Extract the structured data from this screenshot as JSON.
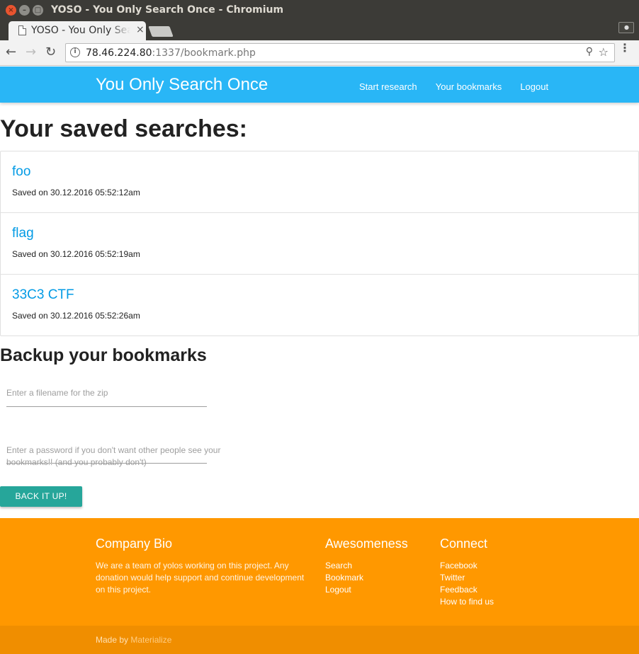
{
  "window": {
    "title": "YOSO - You Only Search Once - Chromium",
    "close_glyph": "×",
    "min_glyph": "–",
    "max_glyph": "□"
  },
  "tab": {
    "title": "YOSO - You Only Search Once",
    "close_glyph": "×"
  },
  "toolbar": {
    "url_host": "78.46.224.80",
    "url_rest": ":1337/bookmark.php",
    "back_glyph": "←",
    "forward_glyph": "→",
    "reload_glyph": "↻",
    "info_glyph": "i",
    "zoom_glyph": "⚲",
    "star_glyph": "☆",
    "menu_glyph": "⋮"
  },
  "navbar": {
    "brand": "You Only Search Once",
    "links": [
      "Start research",
      "Your bookmarks",
      "Logout"
    ],
    "color": "#29b6f6"
  },
  "main": {
    "title": "Your saved searches:",
    "searches": [
      {
        "title": "foo",
        "saved": "Saved on 30.12.2016 05:52:12am"
      },
      {
        "title": "flag",
        "saved": "Saved on 30.12.2016 05:52:19am"
      },
      {
        "title": "33C3 CTF",
        "saved": "Saved on 30.12.2016 05:52:26am"
      }
    ],
    "backup": {
      "title": "Backup your bookmarks",
      "filename_placeholder": "Enter a filename for the zip",
      "password_placeholder": "Enter a password if you don't want other people see your bookmarks!! (and you probably don't)",
      "button_label": "BACK IT UP!",
      "button_color": "#26a69a"
    }
  },
  "footer": {
    "color": "#ff9800",
    "bio": {
      "title": "Company Bio",
      "text": "We are a team of yolos working on this project. Any donation would help support and continue development on this project."
    },
    "awesomeness": {
      "title": "Awesomeness",
      "links": [
        "Search",
        "Bookmark",
        "Logout"
      ]
    },
    "connect": {
      "title": "Connect",
      "links": [
        "Facebook",
        "Twitter",
        "Feedback",
        "How to find us"
      ]
    },
    "made_by_prefix": "Made by ",
    "made_by_link": "Materialize"
  },
  "icons": {
    "tab": "document-icon",
    "profile": "user-icon",
    "omnibox_info": "info-icon",
    "omnibox_zoom": "zoom-icon",
    "omnibox_star": "bookmark-star-icon"
  }
}
